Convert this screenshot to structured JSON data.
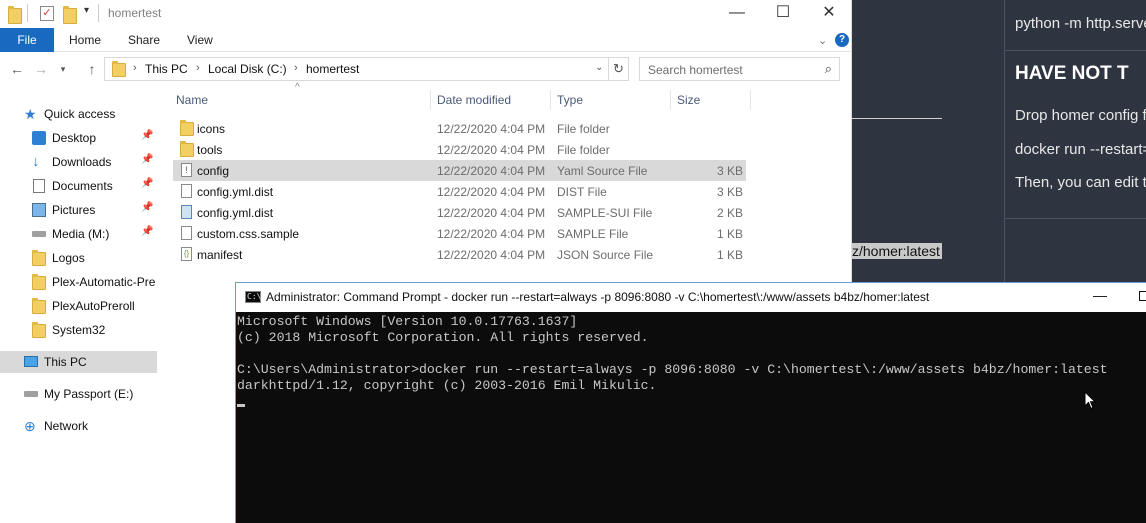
{
  "explorer": {
    "title": "homertest",
    "window_controls": {
      "minimize": "—",
      "maximize": "☐",
      "close": "✕"
    },
    "ribbon": {
      "file": "File",
      "tabs": [
        "Home",
        "Share",
        "View"
      ],
      "help": "?"
    },
    "address": {
      "crumbs": [
        "This PC",
        "Local Disk (C:)",
        "homertest"
      ]
    },
    "search": {
      "placeholder": "Search homertest"
    },
    "nav": {
      "quick_access": "Quick access",
      "items": [
        {
          "label": "Desktop"
        },
        {
          "label": "Downloads"
        },
        {
          "label": "Documents"
        },
        {
          "label": "Pictures"
        },
        {
          "label": "Media (M:)"
        },
        {
          "label": "Logos"
        },
        {
          "label": "Plex-Automatic-Pre"
        },
        {
          "label": "PlexAutoPreroll"
        },
        {
          "label": "System32"
        }
      ],
      "this_pc": "This PC",
      "passport": "My Passport (E:)",
      "network": "Network"
    },
    "columns": {
      "name": "Name",
      "date": "Date modified",
      "type": "Type",
      "size": "Size"
    },
    "files": [
      {
        "name": "icons",
        "date": "12/22/2020 4:04 PM",
        "type": "File folder",
        "size": ""
      },
      {
        "name": "tools",
        "date": "12/22/2020 4:04 PM",
        "type": "File folder",
        "size": ""
      },
      {
        "name": "config",
        "date": "12/22/2020 4:04 PM",
        "type": "Yaml Source File",
        "size": "3 KB"
      },
      {
        "name": "config.yml.dist",
        "date": "12/22/2020 4:04 PM",
        "type": "DIST File",
        "size": "3 KB"
      },
      {
        "name": "config.yml.dist",
        "date": "12/22/2020 4:04 PM",
        "type": "SAMPLE-SUI File",
        "size": "2 KB"
      },
      {
        "name": "custom.css.sample",
        "date": "12/22/2020 4:04 PM",
        "type": "SAMPLE File",
        "size": "1 KB"
      },
      {
        "name": "manifest",
        "date": "12/22/2020 4:04 PM",
        "type": "JSON Source File",
        "size": "1 KB"
      }
    ]
  },
  "cmd": {
    "title": "Administrator: Command Prompt - docker  run --restart=always -p 8096:8080 -v C:\\homertest\\:/www/assets b4bz/homer:latest",
    "lines": [
      "Microsoft Windows [Version 10.0.17763.1637]",
      "(c) 2018 Microsoft Corporation. All rights reserved.",
      "",
      "C:\\Users\\Administrator>docker run --restart=always -p 8096:8080 -v C:\\homertest\\:/www/assets b4bz/homer:latest",
      "darkhttpd/1.12, copyright (c) 2003-2016 Emil Mikulic."
    ]
  },
  "webpage": {
    "line1": "python -m http.serve",
    "heading": "HAVE NOT T",
    "line2": "Drop homer config f",
    "line3": "docker run --restart=",
    "line4": "Then, you can edit t",
    "code_fragment": "z/homer:latest"
  }
}
